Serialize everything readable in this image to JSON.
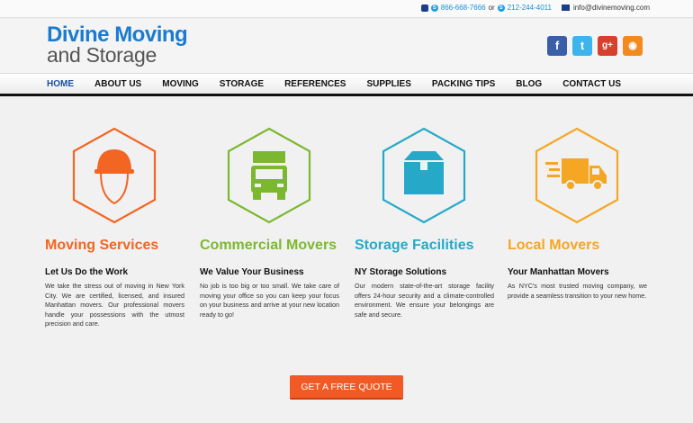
{
  "topbar": {
    "phone_1": "866-668-7666",
    "or": "or",
    "phone_2": "212-244-4011",
    "email": "info@divinemoving.com"
  },
  "header": {
    "logo_line_1": "Divine Moving",
    "logo_line_2": "and Storage",
    "social": [
      {
        "name": "facebook",
        "glyph": "f",
        "color": "#3b5ea8"
      },
      {
        "name": "twitter",
        "glyph": "t",
        "color": "#3cb4ec"
      },
      {
        "name": "google-plus",
        "glyph": "g+",
        "color": "#d6402e"
      },
      {
        "name": "rss",
        "glyph": "◉",
        "color": "#f28a1e"
      }
    ]
  },
  "nav": {
    "items": [
      "HOME",
      "ABOUT US",
      "MOVING",
      "STORAGE",
      "REFERENCES",
      "SUPPLIES",
      "PACKING TIPS",
      "BLOG",
      "CONTACT US"
    ],
    "active": "HOME"
  },
  "services": [
    {
      "icon": "mover-hardhat-icon",
      "color": "#f26522",
      "title": "Moving Services",
      "subtitle": "Let Us Do the Work",
      "text": "We take the stress out of moving in New York City. We are certified, licensed, and insured Manhattan movers. Our professional movers handle your possessions with the utmost precision and care."
    },
    {
      "icon": "truck-front-icon",
      "color": "#7cb82f",
      "title": "Commercial Movers",
      "subtitle": "We Value Your Business",
      "text": "No job is too big or too small. We take care of moving your office so you can keep your focus on your business and arrive at your new location ready to go!"
    },
    {
      "icon": "storage-box-icon",
      "color": "#26a9c8",
      "title": "Storage Facilities",
      "subtitle": "NY Storage Solutions",
      "text": "Our modern state-of-the-art storage facility offers 24-hour security and a climate-controlled environment. We ensure your belongings are safe and secure."
    },
    {
      "icon": "moving-truck-icon",
      "color": "#f5a623",
      "title": "Local Movers",
      "subtitle": "Your Manhattan Movers",
      "text": "As NYC's most trusted moving company, we provide a seamless transition to your new home."
    }
  ],
  "cta": {
    "label": "GET A FREE QUOTE"
  }
}
